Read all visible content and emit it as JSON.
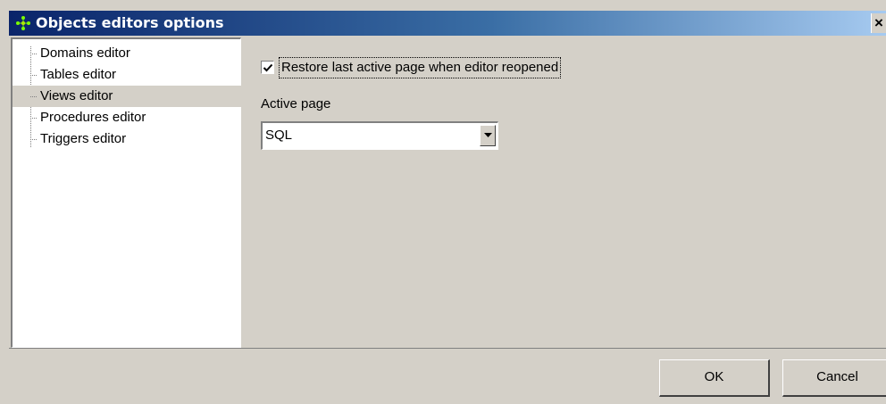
{
  "window": {
    "title": "Objects editors options",
    "close_glyph": "✕",
    "icon": "app-tree-icon"
  },
  "tree": {
    "items": [
      {
        "label": "Domains editor",
        "selected": false
      },
      {
        "label": "Tables editor",
        "selected": false
      },
      {
        "label": "Views editor",
        "selected": true
      },
      {
        "label": "Procedures editor",
        "selected": false
      },
      {
        "label": "Triggers editor",
        "selected": false
      }
    ]
  },
  "options": {
    "restore_checkbox_label": "Restore last active page when editor reopened",
    "restore_checked": true,
    "active_page_label": "Active page",
    "active_page_value": "SQL"
  },
  "buttons": {
    "ok_label": "OK",
    "cancel_label": "Cancel"
  },
  "colors": {
    "titlebar_start": "#0a246a",
    "titlebar_end": "#a6caf0",
    "face": "#d4d0c8"
  }
}
